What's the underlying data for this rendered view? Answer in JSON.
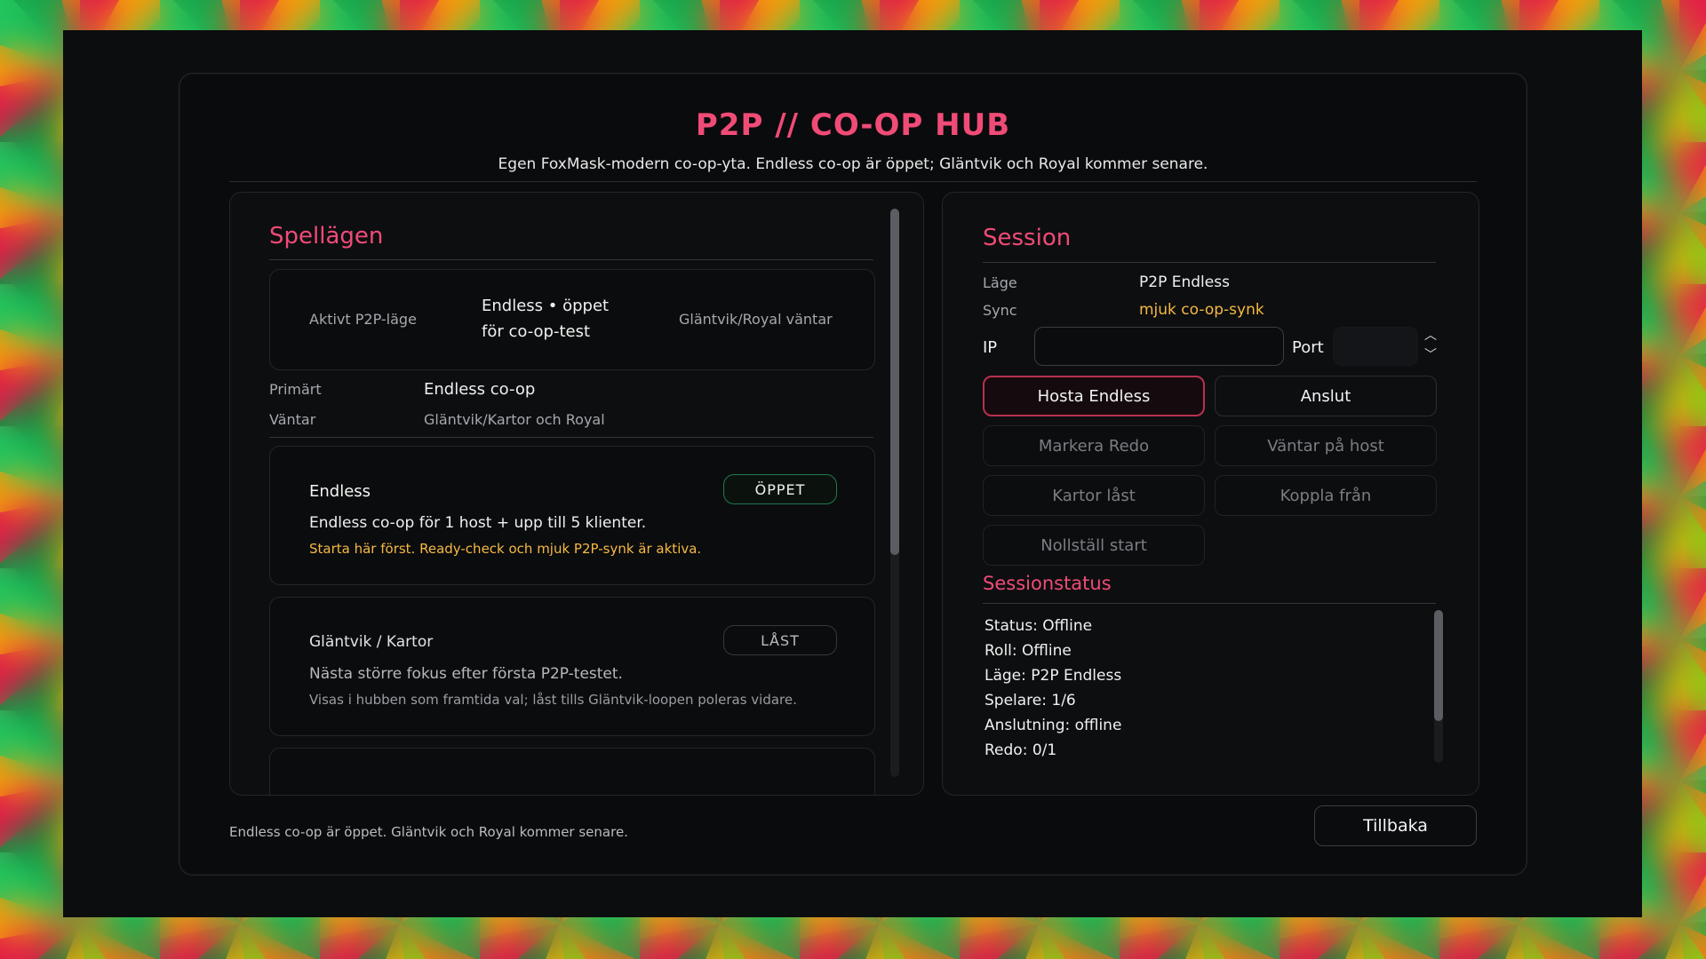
{
  "hub": {
    "title": "P2P // CO-OP HUB",
    "subtitle": "Egen FoxMask-modern co-op-yta. Endless co-op är öppet; Gläntvik och Royal kommer senare."
  },
  "modes": {
    "section_title": "Spellägen",
    "summary": {
      "active_label": "Aktivt P2P-läge",
      "active_value_line1": "Endless • öppet",
      "active_value_line2": "för co-op-test",
      "waiting_note": "Gläntvik/Royal väntar"
    },
    "primary_label": "Primärt",
    "primary_value": "Endless co-op",
    "waiting_label": "Väntar",
    "waiting_value": "Gläntvik/Kartor och Royal",
    "cards": [
      {
        "name": "Endless",
        "badge": "ÖPPET",
        "description": "Endless co-op för 1 host + upp till 5 klienter.",
        "note": "Starta här först. Ready-check och mjuk P2P-synk är aktiva."
      },
      {
        "name": "Gläntvik / Kartor",
        "badge": "LÅST",
        "description": "Nästa större fokus efter första P2P-testet.",
        "note": "Visas i hubben som framtida val; låst tills Gläntvik-loopen poleras vidare."
      }
    ]
  },
  "session": {
    "section_title": "Session",
    "mode_label": "Läge",
    "mode_value": "P2P Endless",
    "sync_label": "Sync",
    "sync_value": "mjuk co-op-synk",
    "ip_label": "IP",
    "ip_value": "",
    "port_label": "Port",
    "port_value": "",
    "buttons": {
      "host": "Hosta Endless",
      "connect": "Anslut",
      "ready": "Markera Redo",
      "waiting_host": "Väntar på host",
      "maps_locked": "Kartor låst",
      "disconnect": "Koppla från",
      "reset_start": "Nollställ start"
    },
    "status_title": "Sessionstatus",
    "status_lines": [
      "Status: Offline",
      "Roll: Offline",
      "Läge: P2P Endless",
      "Spelare: 1/6",
      "Anslutning: offline",
      "Redo: 0/1"
    ]
  },
  "footer": {
    "note": "Endless co-op är öppet. Gläntvik och Royal kommer senare.",
    "back": "Tillbaka"
  },
  "colors": {
    "accent": "#f04b77",
    "sync_value": "#f5b942",
    "badge_open_border": "#1f7a4d"
  }
}
